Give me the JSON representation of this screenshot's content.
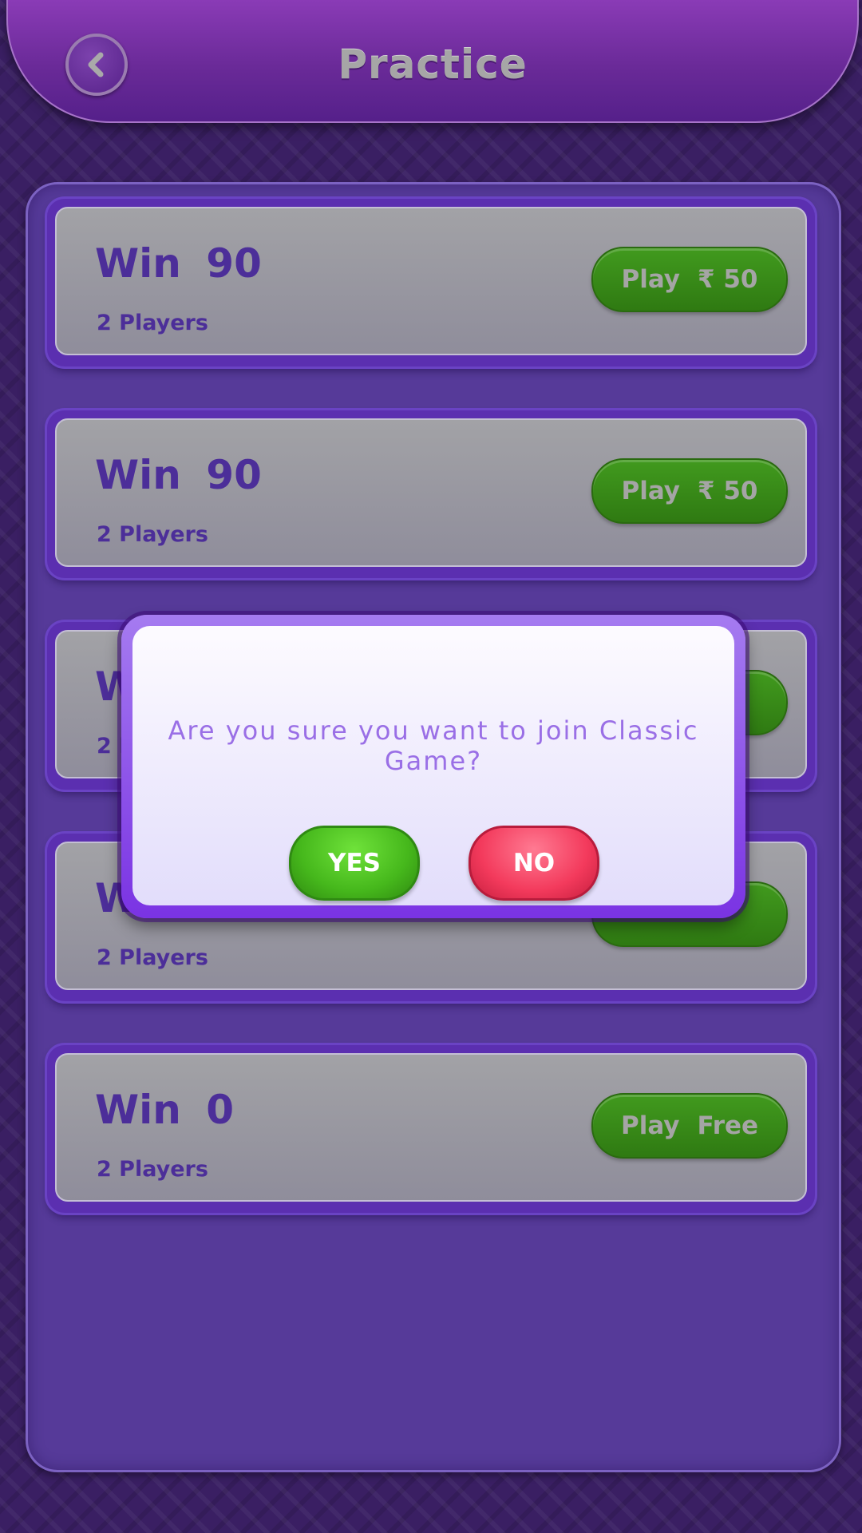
{
  "header": {
    "title": "Practice",
    "back_icon": "chevron-left-icon"
  },
  "games": [
    {
      "win": "Win  90",
      "players": "2 Players",
      "play": "Play",
      "fee": "₹ 50"
    },
    {
      "win": "Win  90",
      "players": "2 Players",
      "play": "Play",
      "fee": "₹ 50"
    },
    {
      "win": "W",
      "players": "2 P",
      "play": "",
      "fee": ""
    },
    {
      "win": "W",
      "players": "2 Players",
      "play": "",
      "fee": ""
    },
    {
      "win": "Win  0",
      "players": "2 Players",
      "play": "Play",
      "fee": "Free"
    }
  ],
  "dialog": {
    "message": "Are you sure you want to join Classic Game?",
    "yes_label": "YES",
    "no_label": "NO"
  },
  "colors": {
    "brand_purple": "#563a99",
    "play_green": "#2f7a12",
    "yes_green": "#46b81c",
    "no_red": "#f33a5c",
    "text_purple": "#4c2e99"
  }
}
